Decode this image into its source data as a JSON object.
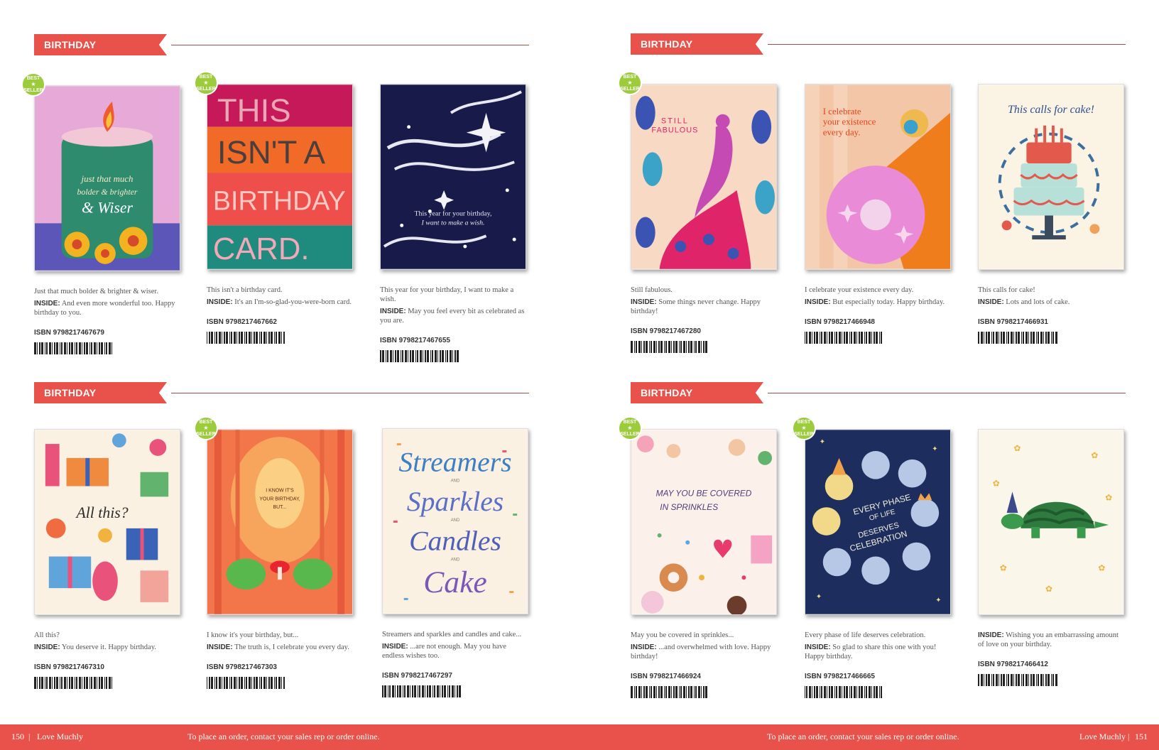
{
  "sections": [
    {
      "label": "BIRTHDAY"
    },
    {
      "label": "BIRTHDAY"
    },
    {
      "label": "BIRTHDAY"
    },
    {
      "label": "BIRTHDAY"
    }
  ],
  "badge": {
    "line1": "BEST",
    "line2": "SELLER"
  },
  "cards": [
    {
      "front": "Just that much bolder & brighter & wiser.",
      "inside_label": "INSIDE:",
      "inside": "And even more wonderful too. Happy birthday to you.",
      "isbn": "ISBN 9798217467679",
      "best_seller": true,
      "art_text": [
        "just that much",
        "bolder & brighter",
        "& Wiser"
      ]
    },
    {
      "front": "This isn't a birthday card.",
      "inside_label": "INSIDE:",
      "inside": "It's an I'm-so-glad-you-were-born card.",
      "isbn": "ISBN 9798217467662",
      "best_seller": true,
      "art_text": [
        "THIS",
        "ISN'T A",
        "BIRTHDAY",
        "CARD."
      ]
    },
    {
      "front": "This year for your birthday, I want to make a wish.",
      "inside_label": "INSIDE:",
      "inside": "May you feel every bit as celebrated as you are.",
      "isbn": "ISBN 9798217467655",
      "best_seller": false,
      "art_text": [
        "This year for your birthday,",
        "I want to make a wish."
      ]
    },
    {
      "front": "Still fabulous.",
      "inside_label": "INSIDE:",
      "inside": "Some things never change. Happy birthday!",
      "isbn": "ISBN 9798217467280",
      "best_seller": true,
      "art_text": [
        "STILL",
        "FABULOUS"
      ]
    },
    {
      "front": "I celebrate your existence every day.",
      "inside_label": "INSIDE:",
      "inside": "But especially today. Happy birthday.",
      "isbn": "ISBN 9798217466948",
      "best_seller": false,
      "art_text": [
        "I celebrate",
        "your existence",
        "every day."
      ]
    },
    {
      "front": "This calls for cake!",
      "inside_label": "INSIDE:",
      "inside": "Lots and lots of cake.",
      "isbn": "ISBN 9798217466931",
      "best_seller": false,
      "art_text": [
        "This calls for cake!"
      ]
    },
    {
      "front": "All this?",
      "inside_label": "INSIDE:",
      "inside": "You deserve it. Happy birthday.",
      "isbn": "ISBN 9798217467310",
      "best_seller": false,
      "art_text": [
        "All this?"
      ]
    },
    {
      "front": "I know it's your birthday, but...",
      "inside_label": "INSIDE:",
      "inside": "The truth is, I celebrate you every day.",
      "isbn": "ISBN 9798217467303",
      "best_seller": true,
      "art_text": [
        "I KNOW IT'S",
        "YOUR BIRTHDAY,",
        "BUT..."
      ]
    },
    {
      "front": "Streamers and sparkles and candles and cake...",
      "inside_label": "INSIDE:",
      "inside": "...are not enough. May you have endless wishes too.",
      "isbn": "ISBN 9798217467297",
      "best_seller": false,
      "art_text": [
        "Streamers",
        "AND",
        "Sparkles",
        "AND",
        "Candles",
        "AND",
        "Cake"
      ]
    },
    {
      "front": "May you be covered in sprinkles...",
      "inside_label": "INSIDE:",
      "inside": "...and overwhelmed with love. Happy birthday!",
      "isbn": "ISBN 9798217466924",
      "best_seller": true,
      "art_text": [
        "MAY YOU BE COVERED",
        "IN SPRINKLES"
      ]
    },
    {
      "front": "Every phase of life deserves celebration.",
      "inside_label": "INSIDE:",
      "inside": "So glad to share this one with you! Happy birthday.",
      "isbn": "ISBN 9798217466665",
      "best_seller": true,
      "art_text": [
        "EVERY PHASE",
        "OF LIFE",
        "DESERVES",
        "CELEBRATION"
      ]
    },
    {
      "front": "",
      "inside_label": "INSIDE:",
      "inside": "Wishing you an embarrassing amount of love on your birthday.",
      "isbn": "ISBN 9798217466412",
      "best_seller": false,
      "art_text": []
    }
  ],
  "footer": {
    "left_page": "150",
    "left_brand": "Love Muchly",
    "separator": "|",
    "left_note": "To place an order, contact your sales rep or order online.",
    "right_note": "To place an order, contact your sales rep or order online.",
    "right_brand": "Love Muchly",
    "right_page": "151"
  }
}
